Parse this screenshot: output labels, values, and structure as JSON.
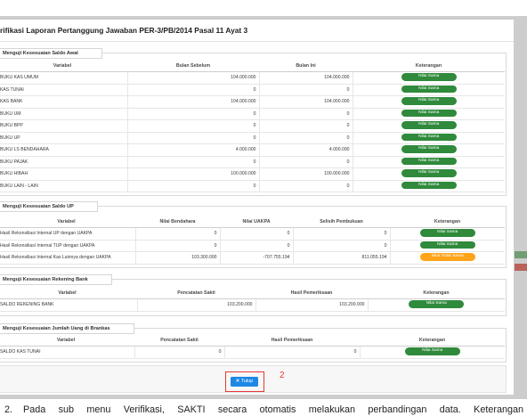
{
  "modal": {
    "title": "rifikasi Laporan Pertanggung Jawaban PER-3/PB/2014 Pasal 11 Ayat 3"
  },
  "saldo_awal": {
    "legend": "Menguji Kesesuaian Saldo Awal",
    "headers": [
      "Variabel",
      "Bulan Sebelum",
      "Bulan Ini",
      "Keterangan"
    ],
    "rows": [
      [
        "BUKU KAS UMUM",
        "104.000.000",
        "104.000.000",
        "Nilai Sama"
      ],
      [
        "KAS TUNAI",
        "0",
        "0",
        "Nilai Sama"
      ],
      [
        "KAS BANK",
        "104.000.000",
        "104.000.000",
        "Nilai Sama"
      ],
      [
        "BUKU UM",
        "0",
        "0",
        "Nilai Sama"
      ],
      [
        "BUKU BPP",
        "0",
        "0",
        "Nilai Sama"
      ],
      [
        "BUKU UP",
        "0",
        "0",
        "Nilai Sama"
      ],
      [
        "BUKU LS BENDAHARA",
        "4.000.000",
        "4.000.000",
        "Nilai Sama"
      ],
      [
        "BUKU PAJAK",
        "0",
        "0",
        "Nilai Sama"
      ],
      [
        "BUKU HIBAH",
        "100.000.000",
        "100.000.000",
        "Nilai Sama"
      ],
      [
        "BUKU LAIN - LAIN",
        "0",
        "0",
        "Nilai Sama"
      ]
    ]
  },
  "saldo_up": {
    "legend": "Menguji Kesesuaian Saldo UP",
    "headers": [
      "Variabel",
      "Nilai Bendahara",
      "Nilai UAKPA",
      "Selisih Pembukuan",
      "Keterangan"
    ],
    "rows": [
      [
        "Hasil Rekonsiliasi Internal UP dengan UAKPA",
        "0",
        "0",
        "0",
        "Nilai Sama"
      ],
      [
        "Hasil Rekonsiliasi Internal TUP dengan UAKPA",
        "0",
        "0",
        "0",
        "Nilai Sama"
      ],
      [
        "Hasil Rekonsiliasi Internal Kas Lainnya dengan UAKPA",
        "103.300.000",
        "-707.755.194",
        "811.055.194",
        "Nilai Tidak Sama"
      ]
    ]
  },
  "rekening_bank": {
    "legend": "Menguji Kesesuaian Rekening Bank",
    "headers": [
      "Variabel",
      "Pencatatan Sakti",
      "Hasil Pemeriksaan",
      "Keterangan"
    ],
    "rows": [
      [
        "SALDO REKENING BANK",
        "103.200.000",
        "103.200.000",
        "Nilai Sama"
      ]
    ]
  },
  "uang_brankas": {
    "legend": "Menguji Kesesuaian Jumlah Uang di Brankas",
    "headers": [
      "Variabel",
      "Pencatatan Sakti",
      "Hasil Pemeriksaan",
      "Keterangan"
    ],
    "rows": [
      [
        "SALDO KAS TUNAI",
        "0",
        "0",
        "Nilai Sama"
      ]
    ]
  },
  "footer": {
    "close_label": "Tutup",
    "close_icon": "close-icon"
  },
  "annotation": {
    "label": "2"
  },
  "document": {
    "item_number": "2.",
    "text": "Pada sub menu Verifikasi, SAKTI secara otomatis melakukan perbandingan data. Keterangan"
  },
  "colors": {
    "badge_same": "#2f8a3b",
    "badge_different": "#ffa319",
    "button_primary": "#1e88e5",
    "annotation": "#e53935",
    "backdrop": "#cdcdcd"
  }
}
